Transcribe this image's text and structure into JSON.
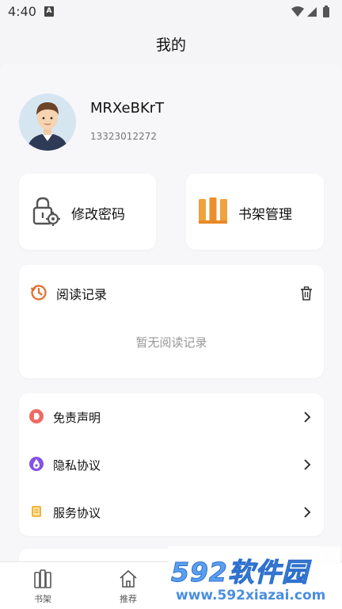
{
  "status_bar": {
    "time": "4:40",
    "notification_glyph": "A",
    "icons": [
      "wifi-icon",
      "signal-icon",
      "battery-icon"
    ]
  },
  "header": {
    "title": "我的"
  },
  "profile": {
    "username": "MRXeBKrT",
    "phone": "13323012272"
  },
  "quick_actions": [
    {
      "label": "修改密码",
      "icon": "lock-gear-icon",
      "color": "#555555"
    },
    {
      "label": "书架管理",
      "icon": "books-icon",
      "color": "#f0a23c"
    }
  ],
  "history": {
    "title": "阅读记录",
    "empty_text": "暂无阅读记录",
    "icon_color": "#e46a2a"
  },
  "menu": [
    {
      "label": "免责声明",
      "icon": "disclaimer-icon",
      "color": "#ee6a63"
    },
    {
      "label": "隐私协议",
      "icon": "privacy-icon",
      "color": "#8452e6"
    },
    {
      "label": "服务协议",
      "icon": "service-icon",
      "color": "#f3b43b"
    }
  ],
  "tabs": [
    {
      "label": "书架",
      "icon": "bookshelf-icon"
    },
    {
      "label": "推荐",
      "icon": "home-icon"
    }
  ],
  "watermark": {
    "brand": "592软件园",
    "url": "www.592xiazai.com",
    "color": "#4a8ee0"
  }
}
